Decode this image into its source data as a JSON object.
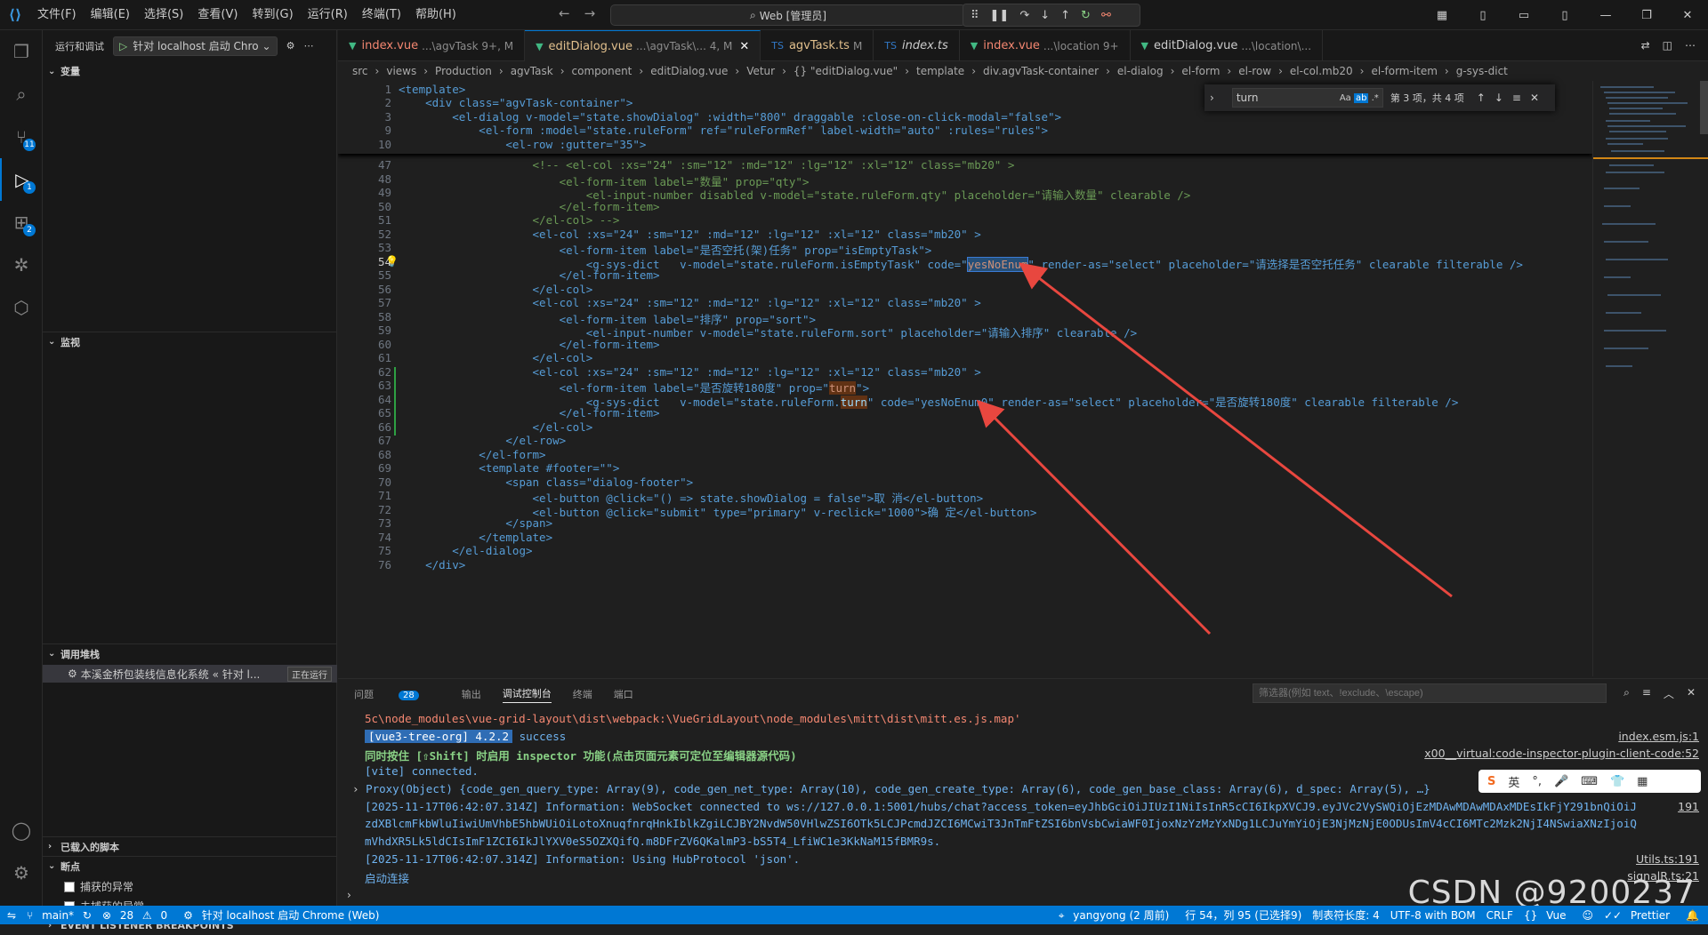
{
  "menu": [
    "文件(F)",
    "编辑(E)",
    "选择(S)",
    "查看(V)",
    "转到(G)",
    "运行(R)",
    "终端(T)",
    "帮助(H)"
  ],
  "command_center": "Web [管理员]",
  "sidebar": {
    "run_label": "运行和调试",
    "launch_config": "针对 localhost 启动 Chro",
    "variables": "变量",
    "watch": "监视",
    "callstack": "调用堆栈",
    "thread_name": "本溪金桥包装线信息化系统 « 针对 l...",
    "thread_status": "正在运行",
    "loaded_scripts": "已载入的脚本",
    "breakpoints": "断点",
    "caught": "捕获的异常",
    "uncaught": "未捕获的异常",
    "event_listener": "EVENT LISTENER BREAKPOINTS"
  },
  "tabs": [
    {
      "name": "index.vue",
      "path": "...\\agvTask 9+, M"
    },
    {
      "name": "editDialog.vue",
      "path": "...\\agvTask\\... 4, M"
    },
    {
      "name": "agvTask.ts",
      "path": "M"
    },
    {
      "name": "index.ts",
      "path": ""
    },
    {
      "name": "index.vue",
      "path": "...\\location 9+"
    },
    {
      "name": "editDialog.vue",
      "path": "...\\location\\..."
    }
  ],
  "breadcrumbs": [
    "src",
    "views",
    "Production",
    "agvTask",
    "component",
    "editDialog.vue",
    "Vetur",
    "{} \"editDialog.vue\"",
    "template",
    "div.agvTask-container",
    "el-dialog",
    "el-form",
    "el-row",
    "el-col.mb20",
    "el-form-item",
    "g-sys-dict"
  ],
  "find": {
    "query": "turn",
    "result": "第 3 项，共 4 项"
  },
  "line_numbers": [
    "1",
    "2",
    "3",
    "9",
    "10",
    "47",
    "48",
    "49",
    "50",
    "51",
    "52",
    "53",
    "54",
    "55",
    "56",
    "57",
    "58",
    "59",
    "60",
    "61",
    "62",
    "63",
    "64",
    "65",
    "66",
    "67",
    "68",
    "69",
    "70",
    "71",
    "72",
    "73",
    "74",
    "75",
    "76"
  ],
  "code": {
    "l1": "<template>",
    "l2": "    <div class=\"agvTask-container\">",
    "l3": "        <el-dialog v-model=\"state.showDialog\" :width=\"800\" draggable :close-on-click-modal=\"false\">",
    "l9": "            <el-form :model=\"state.ruleForm\" ref=\"ruleFormRef\" label-width=\"auto\" :rules=\"rules\">",
    "l10": "                <el-row :gutter=\"35\">",
    "l47": "                    <!-- <el-col :xs=\"24\" :sm=\"12\" :md=\"12\" :lg=\"12\" :xl=\"12\" class=\"mb20\" >",
    "l48": "                        <el-form-item label=\"数量\" prop=\"qty\">",
    "l49": "                            <el-input-number disabled v-model=\"state.ruleForm.qty\" placeholder=\"请输入数量\" clearable />",
    "l50": "                        </el-form-item>",
    "l51": "                    </el-col> -->",
    "l52": "                    <el-col :xs=\"24\" :sm=\"12\" :md=\"12\" :lg=\"12\" :xl=\"12\" class=\"mb20\" >",
    "l53": "                        <el-form-item label=\"是否空托(架)任务\" prop=\"isEmptyTask\">",
    "l54a": "                            <g-sys-dict   v-model=\"state.ruleForm.isEmptyTask\" code=\"",
    "l54b": "yesNoEnum",
    "l54c": "\" render-as=\"select\" placeholder=\"请选择是否空托任务\" clearable filterable />",
    "l55": "                        </el-form-item>",
    "l56": "                    </el-col>",
    "l57": "                    <el-col :xs=\"24\" :sm=\"12\" :md=\"12\" :lg=\"12\" :xl=\"12\" class=\"mb20\" >",
    "l58": "                        <el-form-item label=\"排序\" prop=\"sort\">",
    "l59": "                            <el-input-number v-model=\"state.ruleForm.sort\" placeholder=\"请输入排序\" clearable />",
    "l60": "                        </el-form-item>",
    "l61": "                    </el-col>",
    "l62": "                    <el-col :xs=\"24\" :sm=\"12\" :md=\"12\" :lg=\"12\" :xl=\"12\" class=\"mb20\" >",
    "l63a": "                        <el-form-item label=\"是否旋转180度\" prop=\"",
    "l63b": "turn",
    "l63c": "\">",
    "l64a": "                            <g-sys-dict   v-model=\"state.ruleForm.",
    "l64b": "turn",
    "l64c": "\" code=\"yesNoEnum0\" render-as=\"select\" placeholder=\"是否旋转180度\" clearable filterable />",
    "l65": "                        </el-form-item>",
    "l66": "                    </el-col>",
    "l67": "                </el-row>",
    "l68": "            </el-form>",
    "l69": "            <template #footer=\"\">",
    "l70": "                <span class=\"dialog-footer\">",
    "l71": "                    <el-button @click=\"() => state.showDialog = false\">取 消</el-button>",
    "l72": "                    <el-button @click=\"submit\" type=\"primary\" v-reclick=\"1000\">确 定</el-button>",
    "l73": "                </span>",
    "l74": "            </template>",
    "l75": "        </el-dialog>",
    "l76": "    </div>"
  },
  "panel": {
    "tabs": [
      "问题",
      "输出",
      "调试控制台",
      "终端",
      "端口"
    ],
    "problems_count": "28",
    "filter_placeholder": "筛选器(例如 text、!exclude、\\escape)",
    "lines": [
      "5c\\node_modules\\vue-grid-layout\\dist\\webpack:\\VueGridLayout\\node_modules\\mitt\\dist\\mitt.es.js.map'",
      "[vue3-tree-org] 4.2.2",
      "success",
      "同时按住 [⇧Shift] 时启用 inspector 功能(点击页面元素可定位至编辑器源代码)",
      "[vite] connected.",
      "Proxy(Object) {code_gen_query_type: Array(9), code_gen_net_type: Array(10), code_gen_create_type: Array(6), code_gen_base_class: Array(6), d_spec: Array(5), …}",
      "[2025-11-17T06:42:07.314Z] Information: WebSocket connected to ws://127.0.0.1:5001/hubs/chat?access_token=eyJhbGciOiJIUzI1NiIsInR5cCI6IkpXVCJ9.eyJVc2VySWQiOjEzMDAwMDAwMDAxMDEsIkFjY291bnQiOiJ",
      "zdXBlcmFkbWluIiwiUmVhbE5hbWUiOiLotoXnuqfnrqHnkIblkZgiLCJBY2NvdW50VHlwZSI6OTk5LCJPcmdJZCI6MCwiT3JnTmFtZSI6bnVsbCwiaWF0IjoxNzYzMzYxNDg1LCJuYmYiOjE3NjMzNjE0ODUsImV4cCI6MTc2Mzk2NjI4NSwiaXNzIjoiQ",
      "mVhdXR5Lk5ldCIsImF1ZCI6IkJlYXV0eS5OZXQifQ.m8DFrZV6QKalmP3-bS5T4_LfiWC1e3KkNaM15fBMR9s.",
      "[2025-11-17T06:42:07.314Z] Information: Using HubProtocol 'json'.",
      "启动连接"
    ],
    "sources": [
      "index.esm.js:1",
      "x00__virtual:code-inspector-plugin-client-code:52",
      "191",
      "Utils.ts:191",
      "signalR.ts:21"
    ]
  },
  "ime": "英",
  "status": {
    "branch": "main*",
    "errors": "28",
    "warnings": "0",
    "debug": "针对 localhost 启动 Chrome (Web)",
    "blame": "yangyong (2 周前)",
    "position": "行 54，列 95 (已选择9)",
    "tab": "制表符长度: 4",
    "encoding": "UTF-8 with BOM",
    "eol": "CRLF",
    "lang": "Vue",
    "prettier": "Prettier"
  },
  "watermark": "CSDN @9200237",
  "colors": {
    "accent": "#0078d4",
    "arrow": "#e8473f",
    "vue": "#41b883"
  }
}
